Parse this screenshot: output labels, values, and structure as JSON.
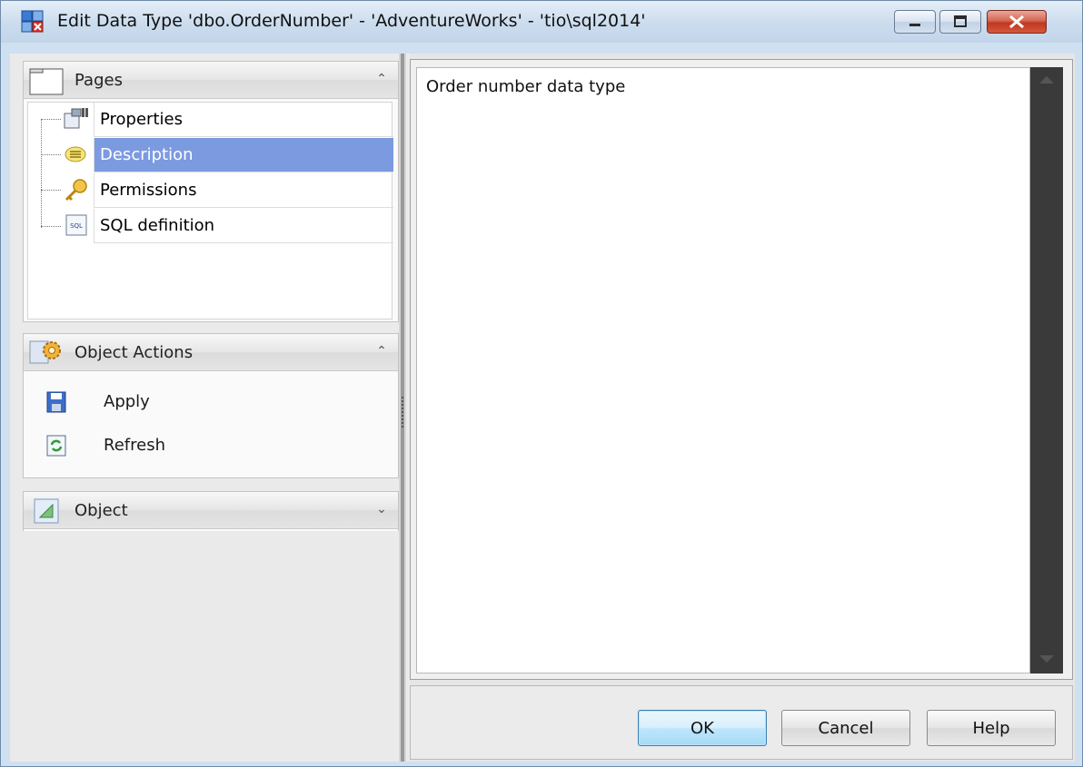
{
  "window": {
    "title": "Edit Data Type 'dbo.OrderNumber' - 'AdventureWorks' - 'tio\\sql2014'"
  },
  "pages_panel": {
    "title": "Pages",
    "items": [
      {
        "label": "Properties",
        "icon": "properties-icon",
        "selected": false
      },
      {
        "label": "Description",
        "icon": "description-icon",
        "selected": true
      },
      {
        "label": "Permissions",
        "icon": "key-icon",
        "selected": false
      },
      {
        "label": "SQL definition",
        "icon": "sql-icon",
        "selected": false
      }
    ]
  },
  "actions_panel": {
    "title": "Object Actions",
    "actions": [
      {
        "label": "Apply",
        "icon": "save-icon"
      },
      {
        "label": "Refresh",
        "icon": "refresh-icon"
      }
    ]
  },
  "object_panel": {
    "title": "Object"
  },
  "editor": {
    "text": "Order number data type"
  },
  "buttons": {
    "ok": "OK",
    "cancel": "Cancel",
    "help": "Help"
  },
  "colors": {
    "selection": "#7c9ae0",
    "titlebar": "#cbdcee",
    "close_button": "#c0391f"
  }
}
